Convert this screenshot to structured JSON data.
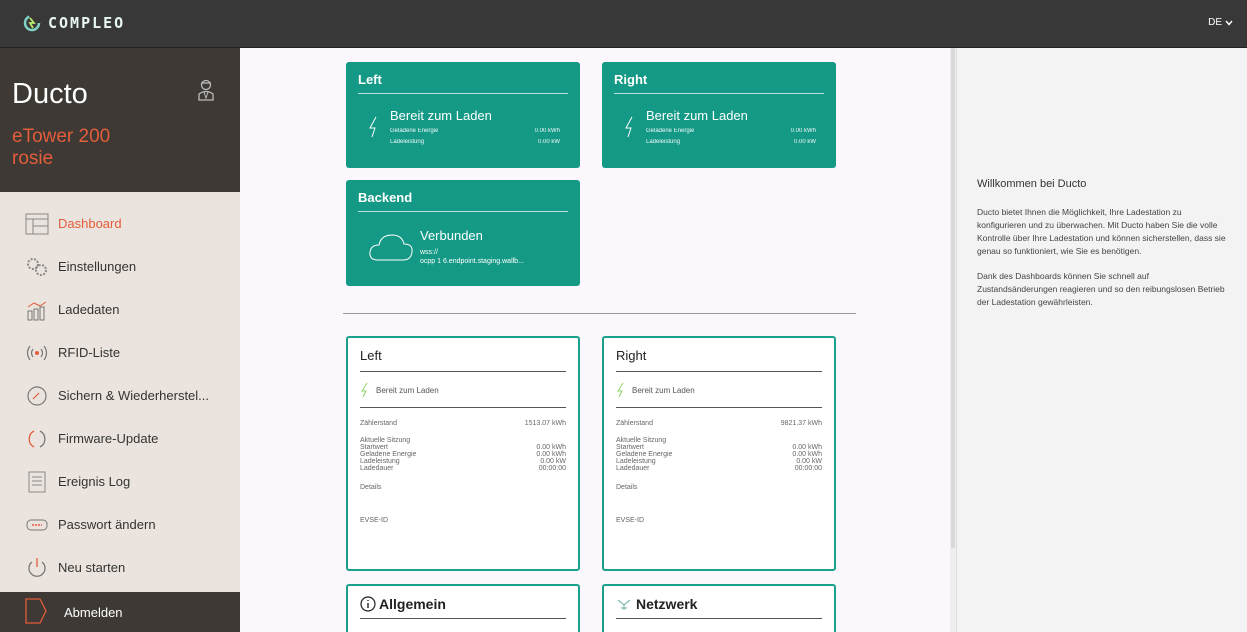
{
  "header": {
    "brand": "COMPLEO",
    "language": "DE"
  },
  "sidebar": {
    "product": "Ducto",
    "device_model": "eTower 200",
    "device_name": "rosie",
    "items": [
      {
        "label": "Dashboard",
        "icon": "dashboard-icon",
        "active": true
      },
      {
        "label": "Einstellungen",
        "icon": "gears-icon"
      },
      {
        "label": "Ladedaten",
        "icon": "bar-chart-icon"
      },
      {
        "label": "RFID-Liste",
        "icon": "rfid-icon"
      },
      {
        "label": "Sichern & Wiederherstel...",
        "icon": "backup-icon"
      },
      {
        "label": "Firmware-Update",
        "icon": "refresh-icon"
      },
      {
        "label": "Ereignis Log",
        "icon": "log-icon"
      },
      {
        "label": "Passwort ändern",
        "icon": "password-icon"
      },
      {
        "label": "Neu starten",
        "icon": "power-icon"
      }
    ],
    "logout": "Abmelden"
  },
  "tiles": {
    "left": {
      "title": "Left",
      "status": "Bereit zum Laden",
      "energy_label": "Geladene Energie",
      "energy_value": "0.00 kWh",
      "power_label": "Ladeleistung",
      "power_value": "0.00 kW"
    },
    "right": {
      "title": "Right",
      "status": "Bereit zum Laden",
      "energy_label": "Geladene Energie",
      "energy_value": "0.00 kWh",
      "power_label": "Ladeleistung",
      "power_value": "0.00 kW"
    },
    "backend": {
      "title": "Backend",
      "status": "Verbunden",
      "url_line1": "wss://",
      "url_line2": "ocpp 1 6.endpoint.staging.wallb..."
    }
  },
  "cards": {
    "left": {
      "title": "Left",
      "status": "Bereit zum Laden",
      "meter_label": "Zählerstand",
      "meter_value": "1513.07 kWh",
      "session_heading": "Aktuelle Sitzung",
      "rows": [
        {
          "label": "Startwert",
          "value": "0.00 kWh"
        },
        {
          "label": "Geladene Energie",
          "value": "0.00 kWh"
        },
        {
          "label": "Ladeleistung",
          "value": "0.00 kW"
        },
        {
          "label": "Ladedauer",
          "value": "00:00:00"
        }
      ],
      "details": "Details",
      "evse": "EVSE-ID"
    },
    "right": {
      "title": "Right",
      "status": "Bereit zum Laden",
      "meter_label": "Zählerstand",
      "meter_value": "9821.37 kWh",
      "session_heading": "Aktuelle Sitzung",
      "rows": [
        {
          "label": "Startwert",
          "value": "0.00 kWh"
        },
        {
          "label": "Geladene Energie",
          "value": "0.00 kWh"
        },
        {
          "label": "Ladeleistung",
          "value": "0.00 kW"
        },
        {
          "label": "Ladedauer",
          "value": "00:00:00"
        }
      ],
      "details": "Details",
      "evse": "EVSE-ID"
    },
    "general": {
      "title": "Allgemein"
    },
    "network": {
      "title": "Netzwerk"
    }
  },
  "welcome": {
    "title": "Willkommen bei Ducto",
    "p1": "Ducto bietet Ihnen die Möglichkeit, Ihre Ladestation zu konfigurieren und zu überwachen. Mit Ducto haben Sie die volle Kontrolle über Ihre Ladestation und können sicherstellen, dass sie genau so funktioniert, wie Sie es benötigen.",
    "p2": "Dank des Dashboards können Sie schnell auf Zustandsänderungen reagieren und so den reibungslosen Betrieb der Ladestation gewährleisten."
  },
  "colors": {
    "accent": "#139985",
    "brand_orange": "#e35c3b",
    "dark": "#3e3934"
  }
}
